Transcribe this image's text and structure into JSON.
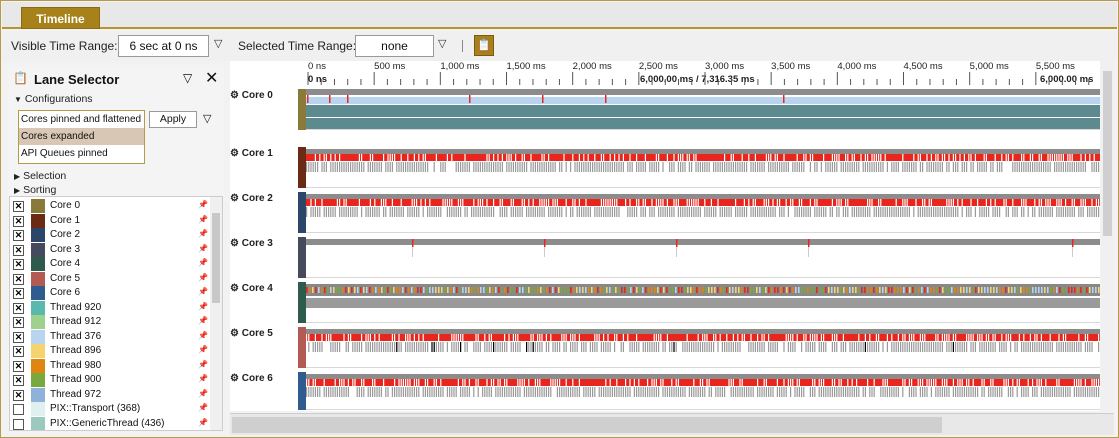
{
  "tab": {
    "label": "Timeline"
  },
  "toolbar": {
    "visible_label": "Visible Time Range:",
    "visible_value": "6 sec at 0 ns",
    "selected_label": "Selected Time Range:",
    "selected_value": "none"
  },
  "lane_selector": {
    "title": "Lane Selector",
    "configurations_label": "Configurations",
    "configurations": [
      "Cores pinned and flattened",
      "Cores expanded",
      "API Queues pinned"
    ],
    "selected_configuration": "Cores expanded",
    "apply_label": "Apply",
    "selection_label": "Selection",
    "sorting_label": "Sorting",
    "lanes": [
      {
        "name": "Core 0",
        "checked": true,
        "color": "#8a7a3a"
      },
      {
        "name": "Core 1",
        "checked": true,
        "color": "#6b2a14"
      },
      {
        "name": "Core 2",
        "checked": true,
        "color": "#2c4669"
      },
      {
        "name": "Core 3",
        "checked": true,
        "color": "#454b5c"
      },
      {
        "name": "Core 4",
        "checked": true,
        "color": "#2f5b4e"
      },
      {
        "name": "Core 5",
        "checked": true,
        "color": "#b35a55"
      },
      {
        "name": "Core 6",
        "checked": true,
        "color": "#2e5c8e"
      },
      {
        "name": "Thread 920",
        "checked": true,
        "color": "#5ab9ad"
      },
      {
        "name": "Thread 912",
        "checked": true,
        "color": "#9ed08e"
      },
      {
        "name": "Thread 376",
        "checked": true,
        "color": "#b8d4ee"
      },
      {
        "name": "Thread 896",
        "checked": true,
        "color": "#f3d470"
      },
      {
        "name": "Thread 980",
        "checked": true,
        "color": "#e0850f"
      },
      {
        "name": "Thread 900",
        "checked": true,
        "color": "#7aa840"
      },
      {
        "name": "Thread 972",
        "checked": true,
        "color": "#8fb2db"
      },
      {
        "name": "PIX::Transport (368)",
        "checked": false,
        "color": "#dff0ee"
      },
      {
        "name": "PIX::GenericThread (436)",
        "checked": false,
        "color": "#9bc9c0"
      }
    ]
  },
  "ruler": {
    "ticks": [
      "0 ns",
      "500 ms",
      "1,000 ms",
      "1,500 ms",
      "2,000 ms",
      "2,500 ms",
      "3,000 ms",
      "3,500 ms",
      "4,000 ms",
      "4,500 ms",
      "5,000 ms",
      "5,500 ms"
    ],
    "start_label": "0 ns",
    "cursor_label": "6,000.00 ms / 7,316.35 ms",
    "end_label": "6,000.00 ms"
  },
  "cores": [
    {
      "name": "Core 0",
      "color": "#8a7a3a"
    },
    {
      "name": "Core 1",
      "color": "#6b2a14"
    },
    {
      "name": "Core 2",
      "color": "#2c4669"
    },
    {
      "name": "Core 3",
      "color": "#454b5c"
    },
    {
      "name": "Core 4",
      "color": "#2f5b4e"
    },
    {
      "name": "Core 5",
      "color": "#b35a55"
    },
    {
      "name": "Core 6",
      "color": "#2e5c8e"
    }
  ],
  "colors": {
    "accent": "#a7821b",
    "activity_red": "#e8261e",
    "lane_gray": "#8c8c8c",
    "selection_blue": "#b8d4ee",
    "teal": "#5d8a8e"
  }
}
